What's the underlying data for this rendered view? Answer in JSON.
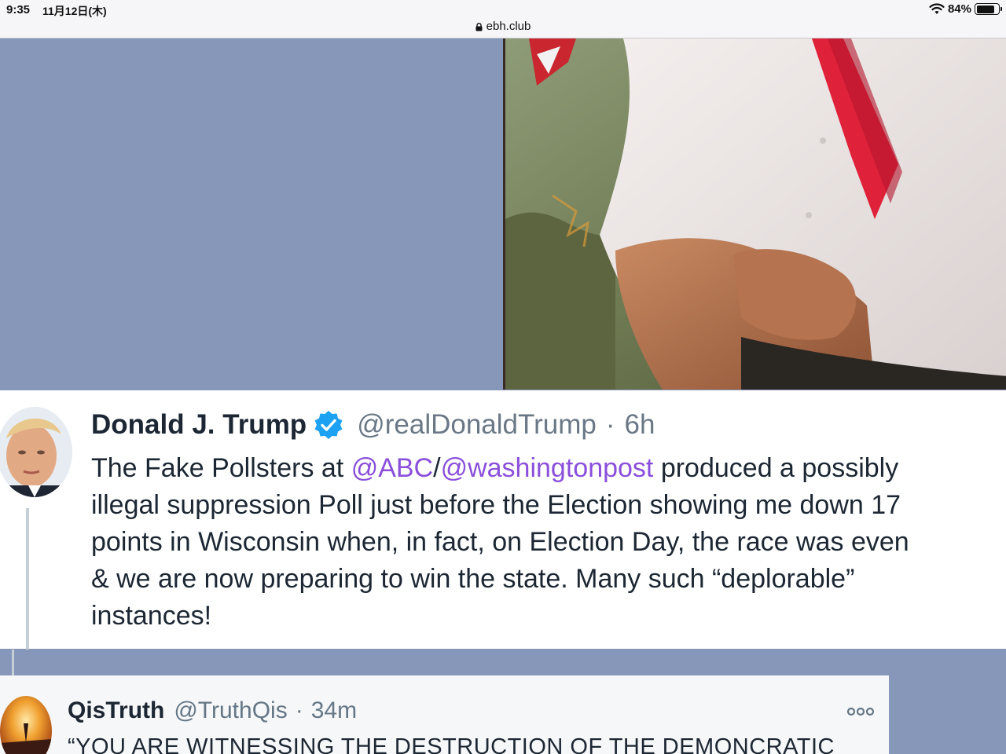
{
  "status_bar": {
    "time": "9:35",
    "date": "11月12日(木)",
    "battery": "84%",
    "battery_level": 0.84,
    "url": "ebh.club"
  },
  "tweet_main": {
    "name": "Donald J. Trump",
    "handle": "@realDonaldTrump",
    "separator": "·",
    "time": "6h",
    "lines": [
      {
        "parts": [
          {
            "text": "The Fake Pollsters at ",
            "mention": false
          },
          {
            "text": "@ABC",
            "mention": true
          },
          {
            "text": "/",
            "mention": false
          },
          {
            "text": "@washingtonpost",
            "mention": true
          },
          {
            "text": " produced a possibly",
            "mention": false
          }
        ]
      },
      {
        "parts": [
          {
            "text": "illegal suppression Poll just before the Election showing me down 17",
            "mention": false
          }
        ]
      },
      {
        "parts": [
          {
            "text": "points in Wisconsin when, in fact, on Election Day, the race was even",
            "mention": false
          }
        ]
      },
      {
        "parts": [
          {
            "text": "& we are now preparing to win the state. Many such “deplorable”",
            "mention": false
          }
        ]
      },
      {
        "parts": [
          {
            "text": "instances!",
            "mention": false
          }
        ]
      }
    ]
  },
  "tweet_reply": {
    "name": "QisTruth",
    "handle": "@TruthQis",
    "separator": "·",
    "time": "34m",
    "text": "“YOU ARE WITNESSING THE DESTRUCTION OF THE DEMONCRATIC",
    "more_icon": "more-icon"
  },
  "colors": {
    "page_background": "#8797b9",
    "mention": "#8a4fdb",
    "verified": "#1da1f2"
  }
}
